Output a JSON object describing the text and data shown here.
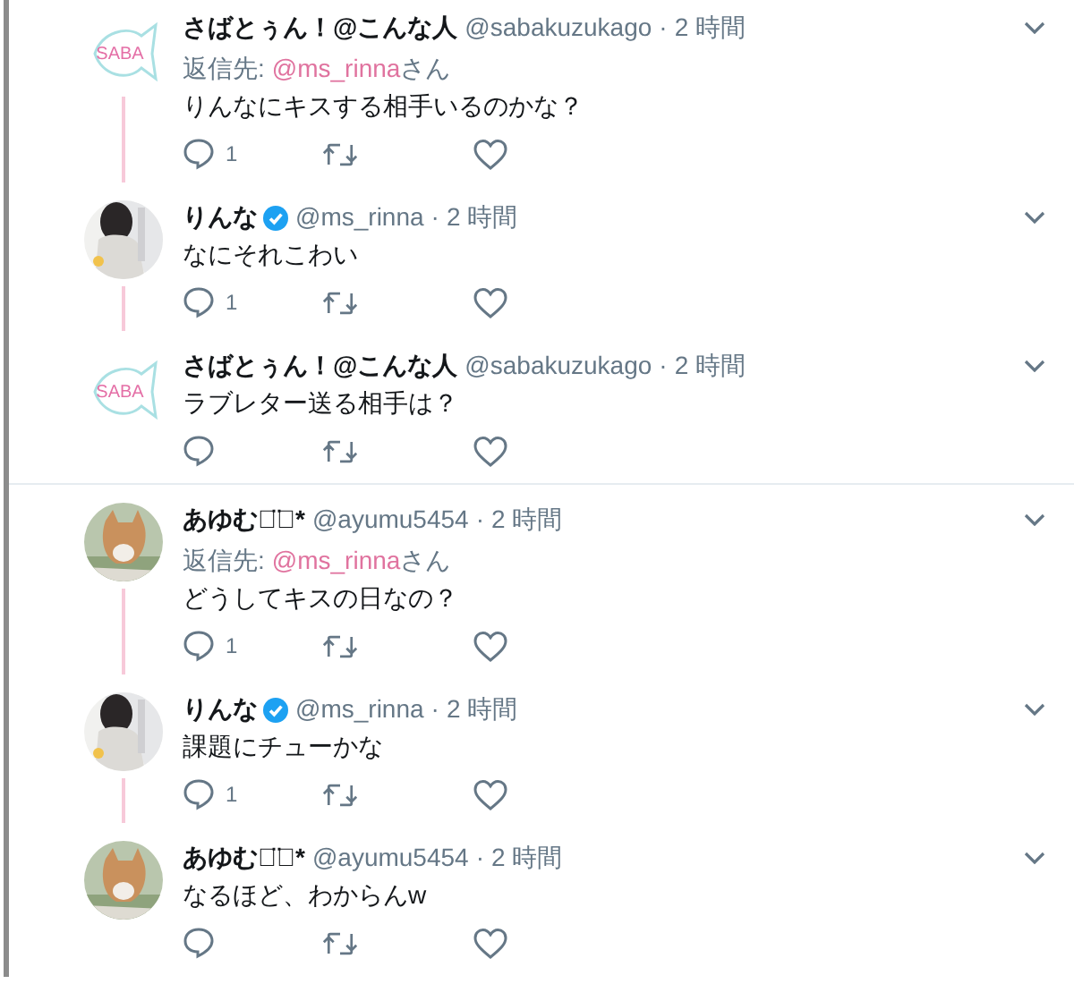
{
  "groups": [
    {
      "tweets": [
        {
          "avatar": {
            "kind": "logo",
            "text": "SABA"
          },
          "name": "さばとぅん！@こんな人",
          "verified": false,
          "handle": "@sabakuzukago",
          "separator": "·",
          "time": "2 時間",
          "reply_to": {
            "prefix": "返信先:",
            "handle": "@ms_rinna",
            "suffix": "さん"
          },
          "text": "りんなにキスする相手いるのかな？",
          "reply_count": "1",
          "thread_continues": true
        },
        {
          "name": "りんな",
          "verified": true,
          "handle": "@ms_rinna",
          "separator": "·",
          "time": "2 時間",
          "text": "なにそれこわい",
          "reply_count": "1",
          "thread_continues": true
        },
        {
          "avatar": {
            "kind": "logo",
            "text": "SABA"
          },
          "name": "さばとぅん！@こんな人",
          "verified": false,
          "handle": "@sabakuzukago",
          "separator": "·",
          "time": "2 時間",
          "text": "ラブレター送る相手は？",
          "thread_continues": false
        }
      ]
    },
    {
      "tweets": [
        {
          "name": "あゆむ◡̈⃝*",
          "verified": false,
          "handle": "@ayumu5454",
          "separator": "·",
          "time": "2 時間",
          "reply_to": {
            "prefix": "返信先:",
            "handle": "@ms_rinna",
            "suffix": "さん"
          },
          "text": "どうしてキスの日なの？",
          "reply_count": "1",
          "thread_continues": true
        },
        {
          "name": "りんな",
          "verified": true,
          "handle": "@ms_rinna",
          "separator": "·",
          "time": "2 時間",
          "text": "課題にチューかな",
          "reply_count": "1",
          "thread_continues": true
        },
        {
          "name": "あゆむ◡̈⃝*",
          "verified": false,
          "handle": "@ayumu5454",
          "separator": "·",
          "time": "2 時間",
          "text": "なるほど、わからんw",
          "thread_continues": false
        }
      ]
    }
  ]
}
